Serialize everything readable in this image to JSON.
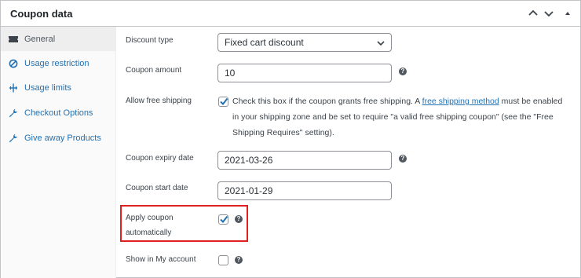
{
  "header": {
    "title": "Coupon data"
  },
  "sidebar": {
    "items": [
      {
        "label": "General",
        "icon": "ticket-icon",
        "active": true
      },
      {
        "label": "Usage restriction",
        "icon": "restriction-icon"
      },
      {
        "label": "Usage limits",
        "icon": "limits-icon"
      },
      {
        "label": "Checkout Options",
        "icon": "wrench-icon"
      },
      {
        "label": "Give away Products",
        "icon": "wrench-icon"
      }
    ]
  },
  "fields": {
    "discount_type": {
      "label": "Discount type",
      "value": "Fixed cart discount"
    },
    "coupon_amount": {
      "label": "Coupon amount",
      "value": "10"
    },
    "free_shipping": {
      "label": "Allow free shipping",
      "checked": true,
      "text_before": "Check this box if the coupon grants free shipping. A ",
      "link": "free shipping method",
      "text_after": " must be enabled in your shipping zone and be set to require \"a valid free shipping coupon\" (see the \"Free Shipping Requires\" setting)."
    },
    "expiry_date": {
      "label": "Coupon expiry date",
      "value": "2021-03-26"
    },
    "start_date": {
      "label": "Coupon start date",
      "value": "2021-01-29"
    },
    "apply_auto": {
      "label_line1": "Apply coupon",
      "label_line2": "automatically",
      "checked": true
    },
    "show_in_account": {
      "label": "Show in My account",
      "checked": false
    }
  },
  "colors": {
    "accent": "#2271b1",
    "highlight": "#e0201f"
  }
}
